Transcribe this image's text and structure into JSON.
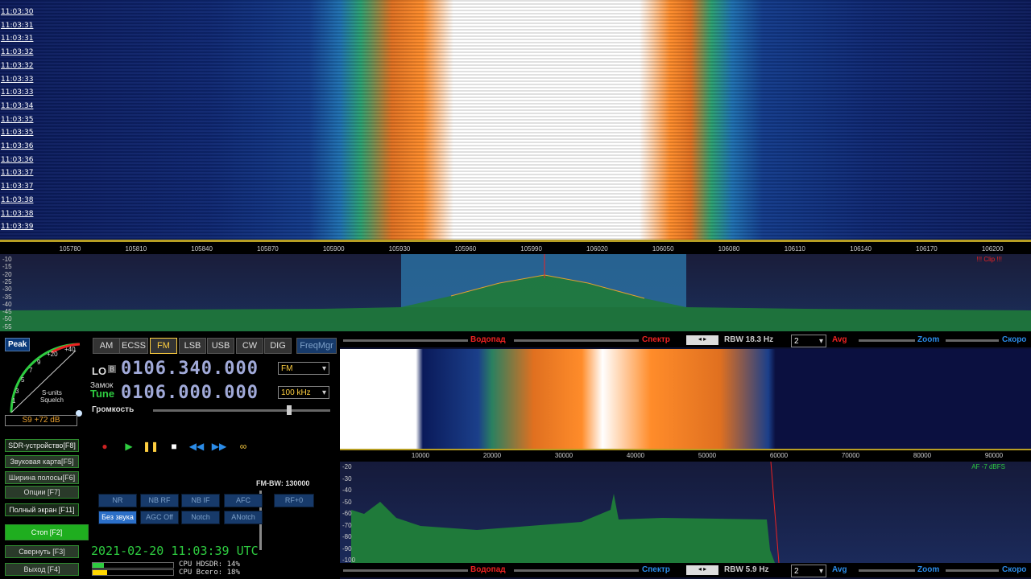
{
  "waterfall": {
    "times": [
      "11:03:30",
      "11:03:31",
      "11:03:31",
      "11:03:32",
      "11:03:32",
      "11:03:33",
      "11:03:33",
      "11:03:34",
      "11:03:35",
      "11:03:35",
      "11:03:36",
      "11:03:36",
      "11:03:37",
      "11:03:37",
      "11:03:38",
      "11:03:38",
      "11:03:39"
    ]
  },
  "freq_axis": [
    "105780",
    "105810",
    "105840",
    "105870",
    "105900",
    "105930",
    "105960",
    "105990",
    "106020",
    "106050",
    "106080",
    "106110",
    "106140",
    "106170",
    "106200"
  ],
  "spectrum": {
    "db_labels": [
      "-10",
      "-15",
      "-20",
      "-25",
      "-30",
      "-35",
      "-40",
      "-45",
      "-50",
      "-55"
    ],
    "clip_text": "!!! Clip !!!"
  },
  "left": {
    "peak": "Peak",
    "meter_scale": [
      "+40",
      "+20",
      "9",
      "7",
      "5",
      "3",
      "1"
    ],
    "meter_label1": "S-units",
    "meter_label2": "Squelch",
    "smeter_readout": "S9 +72 dB",
    "modes": [
      "AM",
      "ECSS",
      "FM",
      "LSB",
      "USB",
      "CW",
      "DIG"
    ],
    "freqmgr": "FreqMgr",
    "lo_label": "LO",
    "lo_badge": "B",
    "lo_freq": "0106.340.000",
    "lo_mode": "FM",
    "lock_label": "Замок",
    "tune_label": "Tune",
    "tune_freq": "0106.000.000",
    "step": "100 kHz",
    "volume_label": "Громкость",
    "side_buttons": [
      "SDR-устройство[F8]",
      "Звуковая карта[F5]",
      "Ширина полосы[F6]",
      "Опции   [F7]",
      "Полный экран [F11]",
      "Стоп    [F2]",
      "Свернуть  [F3]",
      "Выход    [F4]"
    ],
    "fm_bw": "FM-BW: 130000",
    "dsp_row1": [
      "NR",
      "NB RF",
      "NB IF",
      "AFC"
    ],
    "dsp_row2": [
      "Без звука",
      "AGC Off",
      "Notch",
      "ANotch"
    ],
    "rf0": "RF+0",
    "clock": "2021-02-20  11:03:39 UTC",
    "cpu1": "CPU HDSDR: 14%",
    "cpu2": "CPU Всего: 18%"
  },
  "right": {
    "top_toolbar": {
      "waterfall": "Водопад",
      "spectrum": "Спектр",
      "rbw": "RBW 18.3 Hz",
      "avg_value": "2",
      "avg": "Avg",
      "zoom": "Zoom",
      "speed": "Скоро"
    },
    "bottom_toolbar": {
      "waterfall": "Водопад",
      "spectrum": "Спектр",
      "rbw": "RBW  5.9 Hz",
      "avg_value": "2",
      "avg": "Avg",
      "zoom": "Zoom",
      "speed": "Скоро"
    },
    "af_axis": [
      "10000",
      "20000",
      "30000",
      "40000",
      "50000",
      "60000",
      "70000",
      "80000",
      "90000"
    ],
    "af_db": [
      "-20",
      "-30",
      "-40",
      "-50",
      "-60",
      "-70",
      "-80",
      "-90",
      "-100"
    ],
    "af_level": "AF  -7 dBFS"
  },
  "colors": {
    "accent_orange": "#ff8c2a",
    "panel_green": "#2ecc40",
    "spectrum_red": "#e22"
  }
}
